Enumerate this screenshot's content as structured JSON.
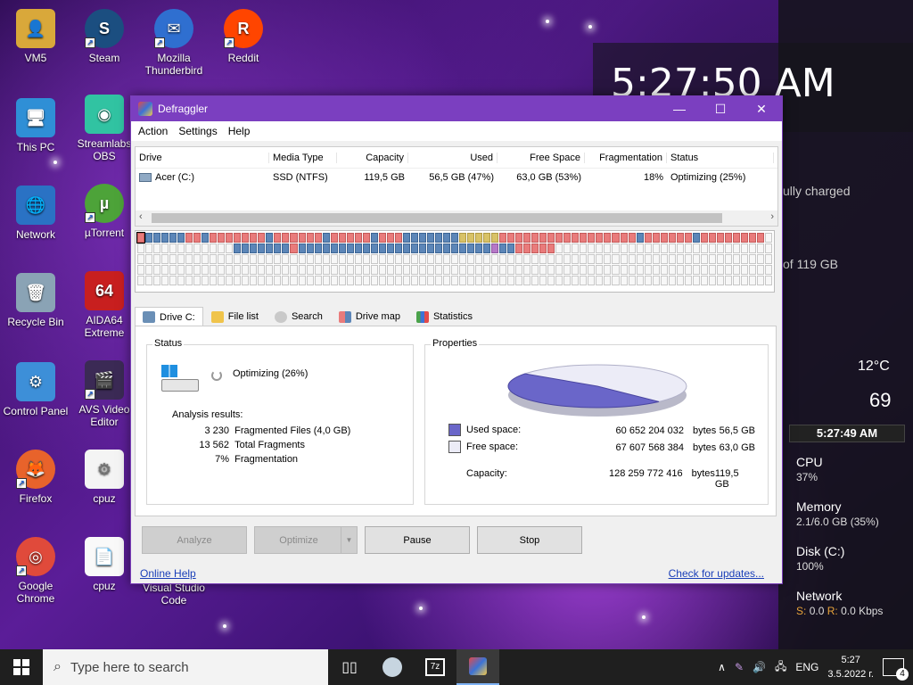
{
  "desktop": {
    "icons": [
      {
        "label": "VM5",
        "glyph": "👤"
      },
      {
        "label": "Steam",
        "glyph": "S"
      },
      {
        "label": "Mozilla Thunderbird",
        "glyph": "✉"
      },
      {
        "label": "Reddit",
        "glyph": "R"
      },
      {
        "label": "This PC",
        "glyph": "🖥"
      },
      {
        "label": "Streamlabs OBS",
        "glyph": "◉"
      },
      {
        "label": "Network",
        "glyph": "🌐"
      },
      {
        "label": "µTorrent",
        "glyph": "µ"
      },
      {
        "label": "Recycle Bin",
        "glyph": "🗑"
      },
      {
        "label": "AIDA64 Extreme",
        "glyph": "64"
      },
      {
        "label": "Control Panel",
        "glyph": "⚙"
      },
      {
        "label": "AVS Video Editor",
        "glyph": "🎬"
      },
      {
        "label": "Firefox",
        "glyph": "🦊"
      },
      {
        "label": "cpuz",
        "glyph": "⚙"
      },
      {
        "label": "Google Chrome",
        "glyph": "◎"
      },
      {
        "label": "cpuz",
        "glyph": "📄"
      },
      {
        "label": "Visual Studio Code",
        "glyph": ""
      }
    ]
  },
  "widgets": {
    "clock": "5:27:50 AM",
    "battery": "ully charged",
    "disk_of": "of 119 GB",
    "temp": "12°C",
    "temp_big": "69",
    "meter_time": "5:27:49 AM",
    "cpu": {
      "label": "CPU",
      "value": "37%"
    },
    "memory": {
      "label": "Memory",
      "value": "2.1/6.0 GB (35%)"
    },
    "disk": {
      "label": "Disk (C:)",
      "value": "100%"
    },
    "network": {
      "label": "Network",
      "s_label": "S:",
      "s_value": "0.0",
      "r_label": "R:",
      "r_value": "0.0 Kbps"
    }
  },
  "window": {
    "title": "Defraggler",
    "menu": [
      "Action",
      "Settings",
      "Help"
    ],
    "drive_list": {
      "columns": [
        "Drive",
        "Media Type",
        "Capacity",
        "Used",
        "Free Space",
        "Fragmentation",
        "Status"
      ],
      "rows": [
        [
          "Acer (C:)",
          "SSD (NTFS)",
          "119,5 GB",
          "56,5 GB (47%)",
          "63,0 GB (53%)",
          "18%",
          "Optimizing (25%)"
        ]
      ]
    },
    "tabs": [
      "Drive C:",
      "File list",
      "Search",
      "Drive map",
      "Statistics"
    ],
    "status": {
      "legend": "Status",
      "state": "Optimizing (26%)",
      "analysis_title": "Analysis results:",
      "results": [
        {
          "value": "3 230",
          "label": "Fragmented Files (4,0 GB)"
        },
        {
          "value": "13 562",
          "label": "Total Fragments"
        },
        {
          "value": "7%",
          "label": "Fragmentation"
        }
      ]
    },
    "properties": {
      "legend": "Properties",
      "used": {
        "label": "Used space:",
        "bytes": "60 652 204 032",
        "unit": "bytes",
        "size": "56,5 GB"
      },
      "free": {
        "label": "Free space:",
        "bytes": "67 607 568 384",
        "unit": "bytes",
        "size": "63,0 GB"
      },
      "capacity": {
        "label": "Capacity:",
        "bytes": "128 259 772 416",
        "unit": "bytes",
        "size": "119,5 GB"
      },
      "used_fraction": 0.47,
      "used_color": "#6a66c9",
      "free_color": "#ececf7"
    },
    "buttons": {
      "analyze": "Analyze",
      "optimize": "Optimize",
      "pause": "Pause",
      "stop": "Stop"
    },
    "footer": {
      "help": "Online Help",
      "updates": "Check for updates..."
    }
  },
  "taskbar": {
    "search_placeholder": "Type here to search",
    "lang": "ENG",
    "time": "5:27",
    "date": "3.5.2022 г.",
    "notifications": "4"
  }
}
